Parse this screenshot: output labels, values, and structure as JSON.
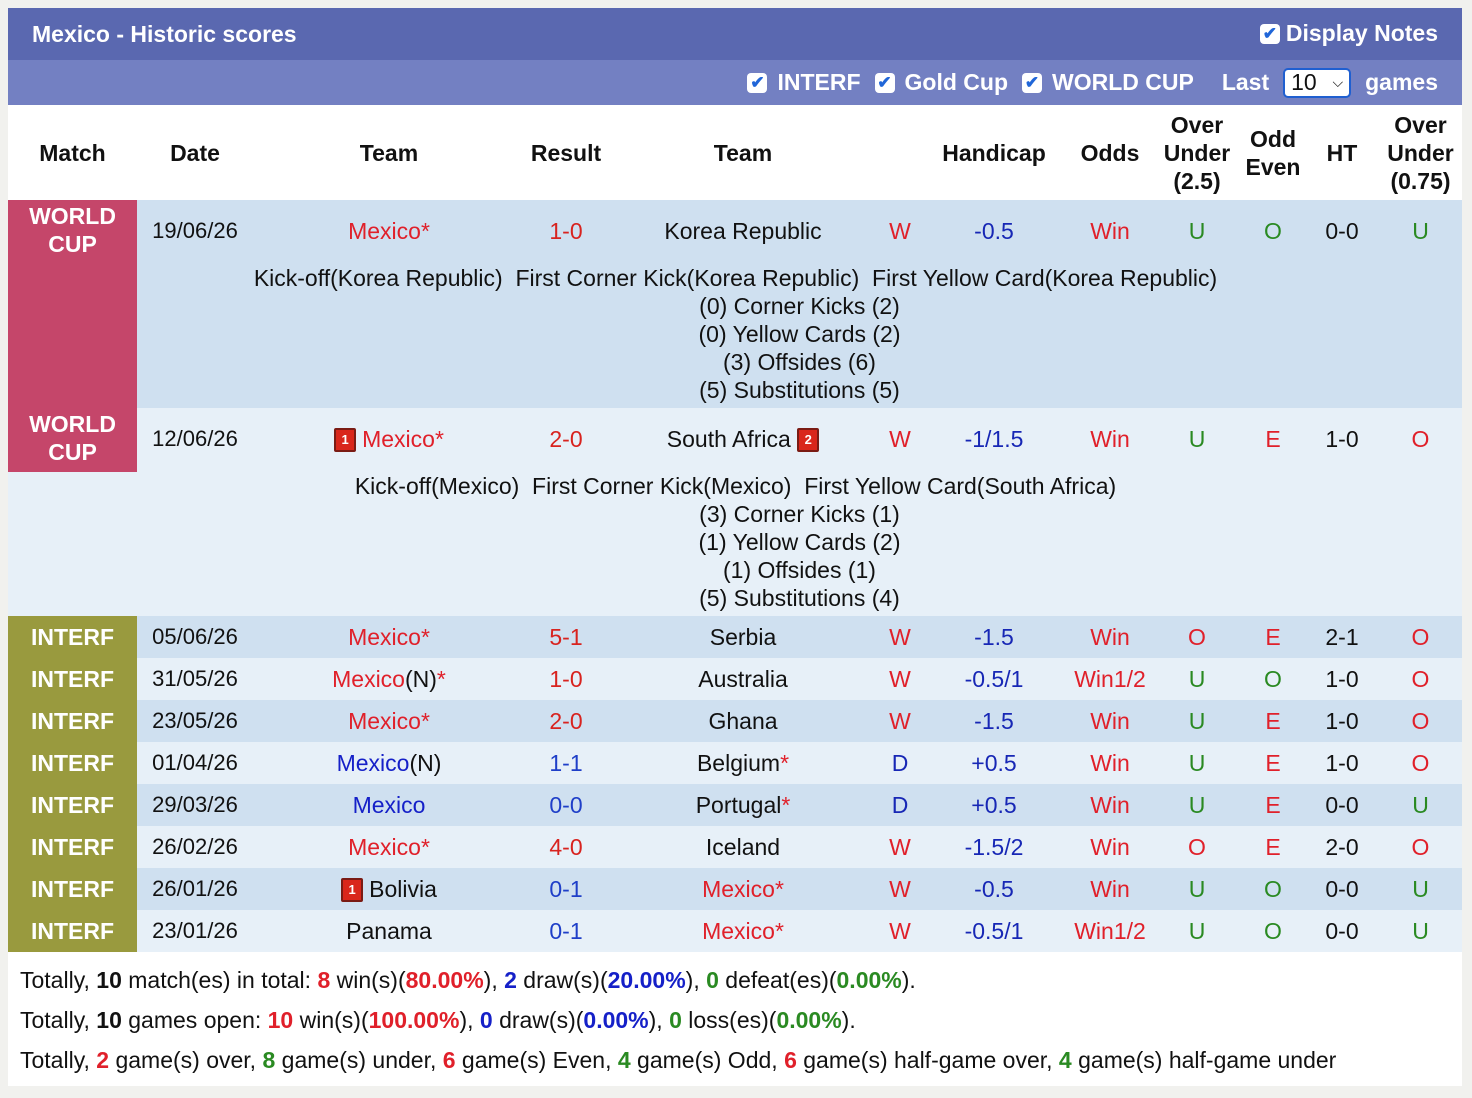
{
  "header": {
    "title": "Mexico - Historic scores",
    "display_notes": "Display Notes",
    "filters": [
      "INTERF",
      "Gold Cup",
      "WORLD CUP"
    ],
    "last_label": "Last",
    "last_value": "10",
    "games_label": "games"
  },
  "columns": {
    "match": "Match",
    "date": "Date",
    "team1": "Team",
    "result": "Result",
    "team2": "Team",
    "handicap": "Handicap",
    "odds": "Odds",
    "ou25_1": "Over",
    "ou25_2": "Under",
    "ou25_3": "(2.5)",
    "oe_1": "Odd",
    "oe_2": "Even",
    "ht": "HT",
    "ou075_1": "Over",
    "ou075_2": "Under",
    "ou075_3": "(0.75)"
  },
  "matches": [
    {
      "comp1": "WORLD",
      "comp2": "CUP",
      "date": "19/06/26",
      "team1": "Mexico",
      "team1_suffix": "*",
      "result": "1-0",
      "team2": "Korea Republic",
      "wl": "W",
      "hcap": "-0.5",
      "odds": "Win",
      "ou": "U",
      "oe": "O",
      "ht": "0-0",
      "ou2": "U",
      "note_line1": "Kick-off(Korea Republic)  First Corner Kick(Korea Republic)  First Yellow Card(Korea Republic)",
      "note_lines": [
        "(0) Corner Kicks (2)",
        "(0) Yellow Cards (2)",
        "(3) Offsides (6)",
        "(5) Substitutions (5)"
      ]
    },
    {
      "comp1": "WORLD",
      "comp2": "CUP",
      "date": "12/06/26",
      "card1": "1",
      "team1": "Mexico",
      "team1_suffix": "*",
      "result": "2-0",
      "team2": "South Africa",
      "card2": "2",
      "wl": "W",
      "hcap": "-1/1.5",
      "odds": "Win",
      "ou": "U",
      "oe": "E",
      "ht": "1-0",
      "ou2": "O",
      "note_line1": "Kick-off(Mexico)  First Corner Kick(Mexico)  First Yellow Card(South Africa)",
      "note_lines": [
        "(3) Corner Kicks (1)",
        "(1) Yellow Cards (2)",
        "(1) Offsides (1)",
        "(5) Substitutions (4)"
      ]
    },
    {
      "comp": "INTERF",
      "date": "05/06/26",
      "team1": "Mexico",
      "team1_suffix": "*",
      "result": "5-1",
      "team2": "Serbia",
      "wl": "W",
      "hcap": "-1.5",
      "odds": "Win",
      "ou": "O",
      "oe": "E",
      "ht": "2-1",
      "ou2": "O"
    },
    {
      "comp": "INTERF",
      "date": "31/05/26",
      "team1": "Mexico",
      "team1_n": "(N)",
      "team1_suffix": "*",
      "result": "1-0",
      "team2": "Australia",
      "wl": "W",
      "hcap": "-0.5/1",
      "odds": "Win1/2",
      "ou": "U",
      "oe": "O",
      "ht": "1-0",
      "ou2": "O"
    },
    {
      "comp": "INTERF",
      "date": "23/05/26",
      "team1": "Mexico",
      "team1_suffix": "*",
      "result": "2-0",
      "team2": "Ghana",
      "wl": "W",
      "hcap": "-1.5",
      "odds": "Win",
      "ou": "U",
      "oe": "E",
      "ht": "1-0",
      "ou2": "O"
    },
    {
      "comp": "INTERF",
      "date": "01/04/26",
      "team1": "Mexico",
      "team1_n": "(N)",
      "result": "1-1",
      "team2": "Belgium",
      "team2_suffix": "*",
      "wl": "D",
      "hcap": "+0.5",
      "odds": "Win",
      "ou": "U",
      "oe": "E",
      "ht": "1-0",
      "ou2": "O"
    },
    {
      "comp": "INTERF",
      "date": "29/03/26",
      "team1": "Mexico",
      "result": "0-0",
      "team2": "Portugal",
      "team2_suffix": "*",
      "wl": "D",
      "hcap": "+0.5",
      "odds": "Win",
      "ou": "U",
      "oe": "E",
      "ht": "0-0",
      "ou2": "U"
    },
    {
      "comp": "INTERF",
      "date": "26/02/26",
      "team1": "Mexico",
      "team1_suffix": "*",
      "result": "4-0",
      "team2": "Iceland",
      "wl": "W",
      "hcap": "-1.5/2",
      "odds": "Win",
      "ou": "O",
      "oe": "E",
      "ht": "2-0",
      "ou2": "O"
    },
    {
      "comp": "INTERF",
      "date": "26/01/26",
      "card1": "1",
      "team1": "Bolivia",
      "result": "0-1",
      "team2": "Mexico",
      "team2_suffix": "*",
      "wl": "W",
      "hcap": "-0.5",
      "odds": "Win",
      "ou": "U",
      "oe": "O",
      "ht": "0-0",
      "ou2": "U"
    },
    {
      "comp": "INTERF",
      "date": "23/01/26",
      "team1": "Panama",
      "result": "0-1",
      "team2": "Mexico",
      "team2_suffix": "*",
      "wl": "W",
      "hcap": "-0.5/1",
      "odds": "Win1/2",
      "ou": "U",
      "oe": "O",
      "ht": "0-0",
      "ou2": "U"
    }
  ],
  "footer": {
    "line1": {
      "p1": "Totally, ",
      "n1": "10",
      "p2": " match(es) in total: ",
      "n2": "8",
      "p3": " win(s)(",
      "n3": "80.00%",
      "p4": "), ",
      "n4": "2",
      "p5": " draw(s)(",
      "n5": "20.00%",
      "p6": "), ",
      "n6": "0",
      "p7": " defeat(es)(",
      "n7": "0.00%",
      "p8": ")."
    },
    "line2": {
      "p1": "Totally, ",
      "n1": "10",
      "p2": " games open: ",
      "n2": "10",
      "p3": " win(s)(",
      "n3": "100.00%",
      "p4": "), ",
      "n4": "0",
      "p5": " draw(s)(",
      "n5": "0.00%",
      "p6": "), ",
      "n6": "0",
      "p7": " loss(es)(",
      "n7": "0.00%",
      "p8": ")."
    },
    "line3": {
      "p1": "Totally, ",
      "n1": "2",
      "p2": " game(s) over, ",
      "n2": "8",
      "p3": " game(s) under, ",
      "n3": "6",
      "p4": " game(s) Even, ",
      "n4": "4",
      "p5": " game(s) Odd, ",
      "n5": "6",
      "p6": " game(s) half-game over, ",
      "n6": "4",
      "p7": " game(s) half-game under"
    }
  }
}
